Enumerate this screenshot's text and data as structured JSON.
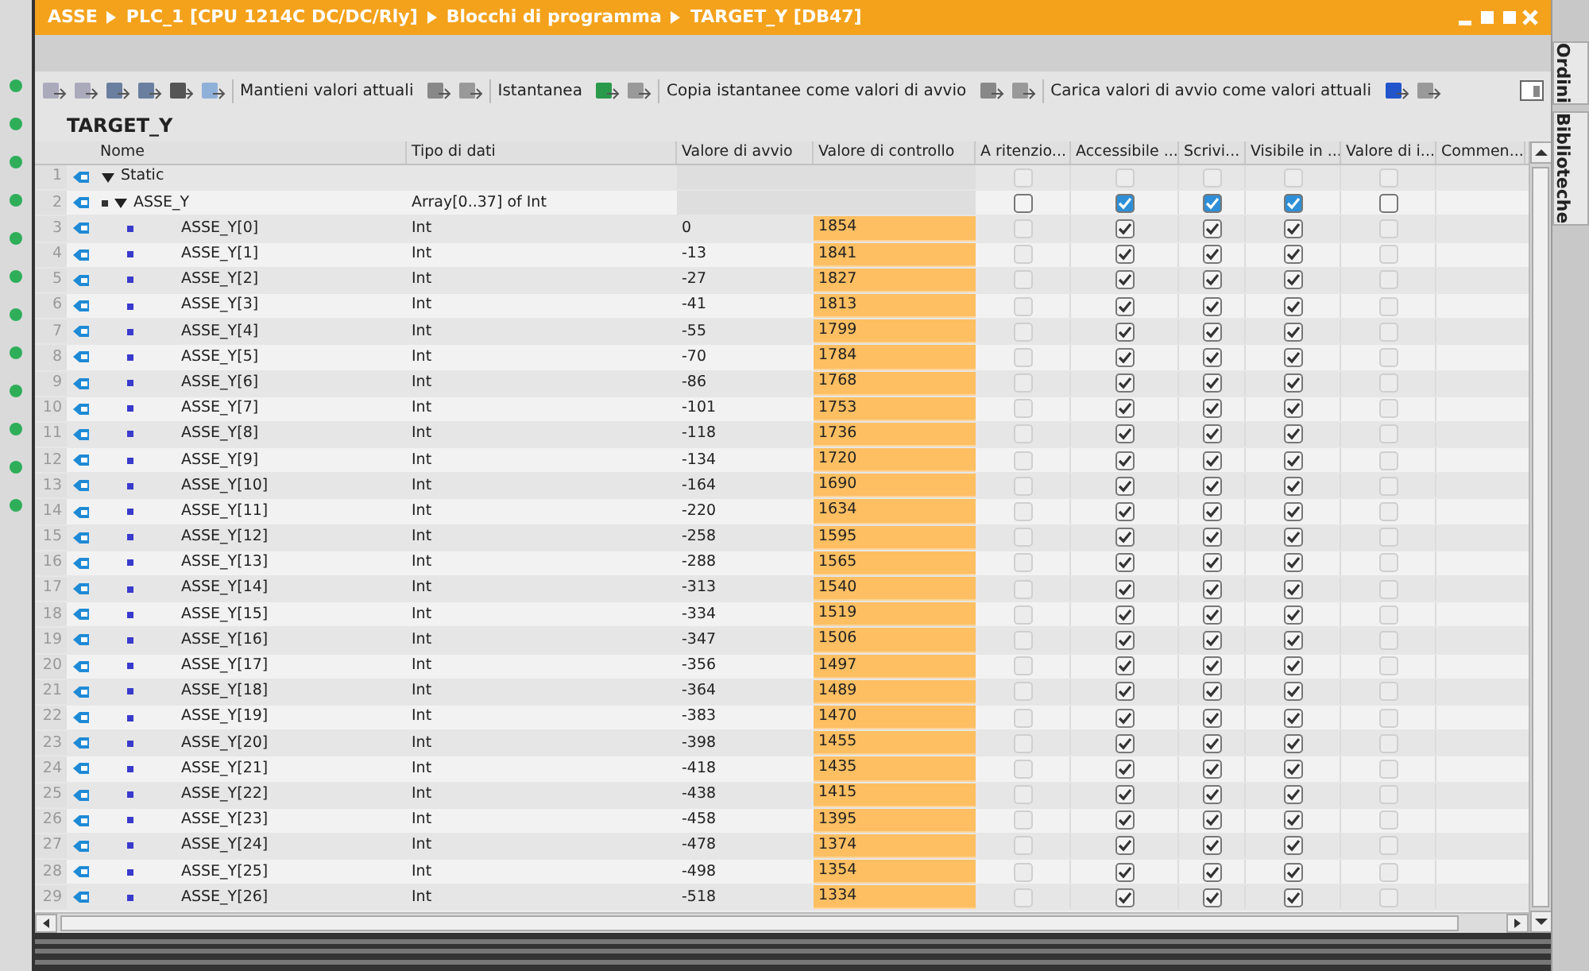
{
  "breadcrumb": [
    "ASSE",
    "PLC_1 [CPU 1214C DC/DC/Rly]",
    "Blocchi di programma",
    "TARGET_Y [DB47]"
  ],
  "toolbar": [
    "Mantieni valori attuali",
    "Istantanea",
    "Copia istantanee come valori di avvio",
    "Carica valori di avvio come valori attuali"
  ],
  "block_title": "TARGET_Y",
  "side_tabs": [
    {
      "label": "Ordini",
      "selected": false
    },
    {
      "label": "Biblioteche",
      "selected": false
    }
  ],
  "table": {
    "columns": [
      "Nome",
      "Tipo di dati",
      "Valore di avvio",
      "Valore di controllo",
      "A ritenzio...",
      "Accessibile ...",
      "Scrivi...",
      "Visibile in ...",
      "Valore di i...",
      "Commen..."
    ],
    "rows": [
      {
        "n": "1",
        "kind": "section",
        "expanded": true,
        "name": "Static",
        "type": "",
        "start": "",
        "monitor": "",
        "flags": [
          false,
          false,
          false,
          false,
          false
        ]
      },
      {
        "n": "2",
        "kind": "array",
        "expanded": true,
        "name": "ASSE_Y",
        "type": "Array[0..37] of Int",
        "start": "",
        "monitor": "",
        "flags": [
          false,
          true,
          true,
          true,
          false
        ]
      },
      {
        "n": "3",
        "kind": "element",
        "name": "ASSE_Y[0]",
        "type": "Int",
        "start": "0",
        "monitor": "1854",
        "flags": [
          false,
          true,
          true,
          true,
          false
        ]
      },
      {
        "n": "4",
        "kind": "element",
        "name": "ASSE_Y[1]",
        "type": "Int",
        "start": "-13",
        "monitor": "1841",
        "flags": [
          false,
          true,
          true,
          true,
          false
        ]
      },
      {
        "n": "5",
        "kind": "element",
        "name": "ASSE_Y[2]",
        "type": "Int",
        "start": "-27",
        "monitor": "1827",
        "flags": [
          false,
          true,
          true,
          true,
          false
        ]
      },
      {
        "n": "6",
        "kind": "element",
        "name": "ASSE_Y[3]",
        "type": "Int",
        "start": "-41",
        "monitor": "1813",
        "flags": [
          false,
          true,
          true,
          true,
          false
        ]
      },
      {
        "n": "7",
        "kind": "element",
        "name": "ASSE_Y[4]",
        "type": "Int",
        "start": "-55",
        "monitor": "1799",
        "flags": [
          false,
          true,
          true,
          true,
          false
        ]
      },
      {
        "n": "8",
        "kind": "element",
        "name": "ASSE_Y[5]",
        "type": "Int",
        "start": "-70",
        "monitor": "1784",
        "flags": [
          false,
          true,
          true,
          true,
          false
        ]
      },
      {
        "n": "9",
        "kind": "element",
        "name": "ASSE_Y[6]",
        "type": "Int",
        "start": "-86",
        "monitor": "1768",
        "flags": [
          false,
          true,
          true,
          true,
          false
        ]
      },
      {
        "n": "10",
        "kind": "element",
        "name": "ASSE_Y[7]",
        "type": "Int",
        "start": "-101",
        "monitor": "1753",
        "flags": [
          false,
          true,
          true,
          true,
          false
        ]
      },
      {
        "n": "11",
        "kind": "element",
        "name": "ASSE_Y[8]",
        "type": "Int",
        "start": "-118",
        "monitor": "1736",
        "flags": [
          false,
          true,
          true,
          true,
          false
        ]
      },
      {
        "n": "12",
        "kind": "element",
        "name": "ASSE_Y[9]",
        "type": "Int",
        "start": "-134",
        "monitor": "1720",
        "flags": [
          false,
          true,
          true,
          true,
          false
        ]
      },
      {
        "n": "13",
        "kind": "element",
        "name": "ASSE_Y[10]",
        "type": "Int",
        "start": "-164",
        "monitor": "1690",
        "flags": [
          false,
          true,
          true,
          true,
          false
        ]
      },
      {
        "n": "14",
        "kind": "element",
        "name": "ASSE_Y[11]",
        "type": "Int",
        "start": "-220",
        "monitor": "1634",
        "flags": [
          false,
          true,
          true,
          true,
          false
        ]
      },
      {
        "n": "15",
        "kind": "element",
        "name": "ASSE_Y[12]",
        "type": "Int",
        "start": "-258",
        "monitor": "1595",
        "flags": [
          false,
          true,
          true,
          true,
          false
        ]
      },
      {
        "n": "16",
        "kind": "element",
        "name": "ASSE_Y[13]",
        "type": "Int",
        "start": "-288",
        "monitor": "1565",
        "flags": [
          false,
          true,
          true,
          true,
          false
        ]
      },
      {
        "n": "17",
        "kind": "element",
        "name": "ASSE_Y[14]",
        "type": "Int",
        "start": "-313",
        "monitor": "1540",
        "flags": [
          false,
          true,
          true,
          true,
          false
        ]
      },
      {
        "n": "18",
        "kind": "element",
        "name": "ASSE_Y[15]",
        "type": "Int",
        "start": "-334",
        "monitor": "1519",
        "flags": [
          false,
          true,
          true,
          true,
          false
        ]
      },
      {
        "n": "19",
        "kind": "element",
        "name": "ASSE_Y[16]",
        "type": "Int",
        "start": "-347",
        "monitor": "1506",
        "flags": [
          false,
          true,
          true,
          true,
          false
        ]
      },
      {
        "n": "20",
        "kind": "element",
        "name": "ASSE_Y[17]",
        "type": "Int",
        "start": "-356",
        "monitor": "1497",
        "flags": [
          false,
          true,
          true,
          true,
          false
        ]
      },
      {
        "n": "21",
        "kind": "element",
        "name": "ASSE_Y[18]",
        "type": "Int",
        "start": "-364",
        "monitor": "1489",
        "flags": [
          false,
          true,
          true,
          true,
          false
        ]
      },
      {
        "n": "22",
        "kind": "element",
        "name": "ASSE_Y[19]",
        "type": "Int",
        "start": "-383",
        "monitor": "1470",
        "flags": [
          false,
          true,
          true,
          true,
          false
        ]
      },
      {
        "n": "23",
        "kind": "element",
        "name": "ASSE_Y[20]",
        "type": "Int",
        "start": "-398",
        "monitor": "1455",
        "flags": [
          false,
          true,
          true,
          true,
          false
        ]
      },
      {
        "n": "24",
        "kind": "element",
        "name": "ASSE_Y[21]",
        "type": "Int",
        "start": "-418",
        "monitor": "1435",
        "flags": [
          false,
          true,
          true,
          true,
          false
        ]
      },
      {
        "n": "25",
        "kind": "element",
        "name": "ASSE_Y[22]",
        "type": "Int",
        "start": "-438",
        "monitor": "1415",
        "flags": [
          false,
          true,
          true,
          true,
          false
        ]
      },
      {
        "n": "26",
        "kind": "element",
        "name": "ASSE_Y[23]",
        "type": "Int",
        "start": "-458",
        "monitor": "1395",
        "flags": [
          false,
          true,
          true,
          true,
          false
        ]
      },
      {
        "n": "27",
        "kind": "element",
        "name": "ASSE_Y[24]",
        "type": "Int",
        "start": "-478",
        "monitor": "1374",
        "flags": [
          false,
          true,
          true,
          true,
          false
        ]
      },
      {
        "n": "28",
        "kind": "element",
        "name": "ASSE_Y[25]",
        "type": "Int",
        "start": "-498",
        "monitor": "1354",
        "flags": [
          false,
          true,
          true,
          true,
          false
        ]
      },
      {
        "n": "29",
        "kind": "element",
        "name": "ASSE_Y[26]",
        "type": "Int",
        "start": "-518",
        "monitor": "1334",
        "flags": [
          false,
          true,
          true,
          true,
          false
        ]
      }
    ]
  }
}
